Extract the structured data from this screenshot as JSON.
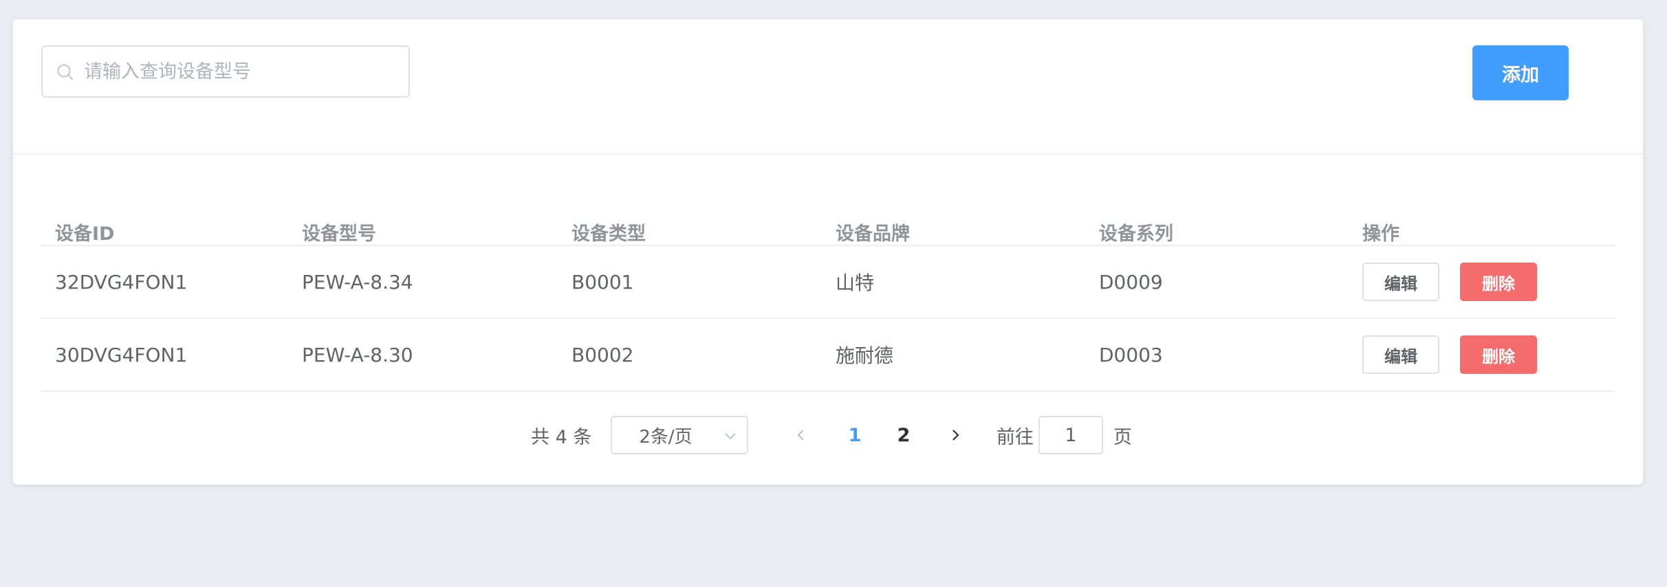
{
  "toolbar": {
    "search_placeholder": "请输入查询设备型号",
    "search_value": "",
    "add_label": "添加"
  },
  "table": {
    "columns": [
      "设备ID",
      "设备型号",
      "设备类型",
      "设备品牌",
      "设备系列",
      "操作"
    ],
    "rows": [
      {
        "id": "32DVG4FON1",
        "model": "PEW-A-8.34",
        "type": "B0001",
        "brand": "山特",
        "series": "D0009",
        "edit": "编辑",
        "delete": "删除"
      },
      {
        "id": "30DVG4FON1",
        "model": "PEW-A-8.30",
        "type": "B0002",
        "brand": "施耐德",
        "series": "D0003",
        "edit": "编辑",
        "delete": "删除"
      }
    ]
  },
  "pagination": {
    "total_text": "共 4 条",
    "page_size": "2条/页",
    "pages": [
      "1",
      "2"
    ],
    "current_page": "1",
    "goto_label": "前往",
    "goto_value": "1",
    "goto_suffix": "页"
  },
  "colors": {
    "primary": "#409eff",
    "danger": "#f56c6c",
    "background": "#e9edf1"
  }
}
